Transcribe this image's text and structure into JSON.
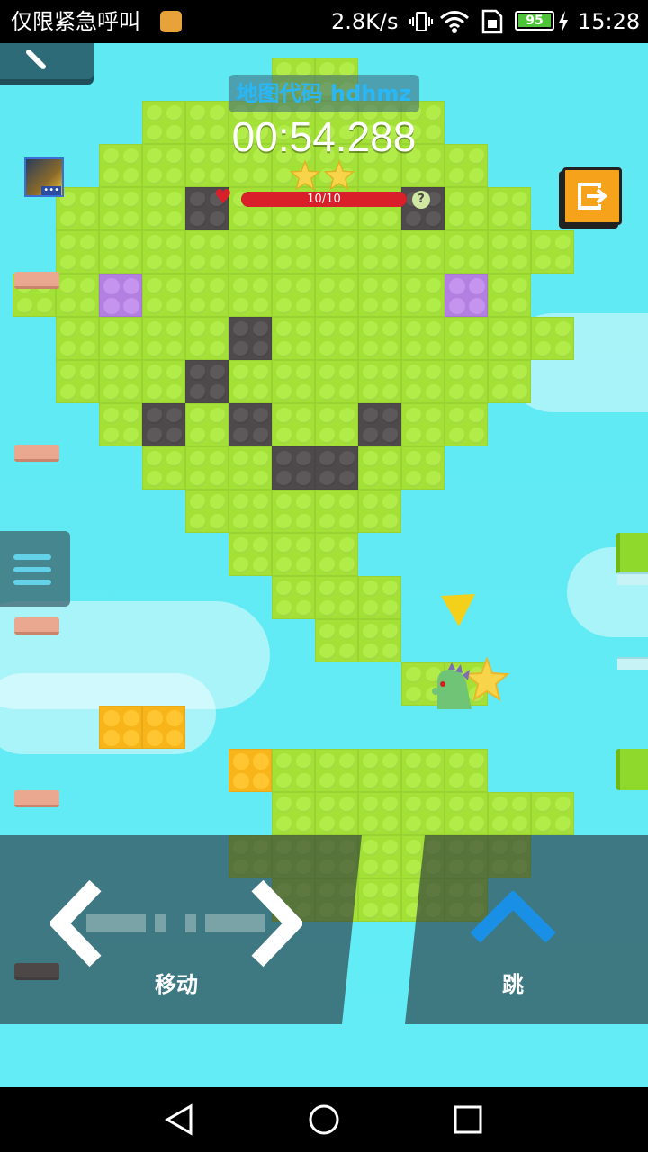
{
  "status_bar": {
    "carrier": "仅限紧急呼叫",
    "speed": "2.8K/s",
    "battery": "95",
    "time": "15:28"
  },
  "hud": {
    "map_code": "地图代码 hdhmz",
    "timer": "00:54.288",
    "stars_earned": 2,
    "health_text": "10/10",
    "health_fraction": 1.0,
    "help_symbol": "?"
  },
  "controls": {
    "move_label": "移动",
    "jump_label": "跳"
  },
  "colors": {
    "sky": "#5fe9f3",
    "block_green": "#a3e137",
    "block_dark": "#4e4a4c",
    "block_purple": "#b37fe0",
    "block_orange": "#f7b51a",
    "health_bar": "#d9202a",
    "jump_arrow": "#1a8fe6",
    "map_code_text": "#2ab7f5"
  },
  "icons": {
    "back": "back-arrow-icon",
    "exit": "exit-level-icon",
    "menu": "hamburger-menu-icon",
    "avatar": "player-avatar-icon"
  }
}
